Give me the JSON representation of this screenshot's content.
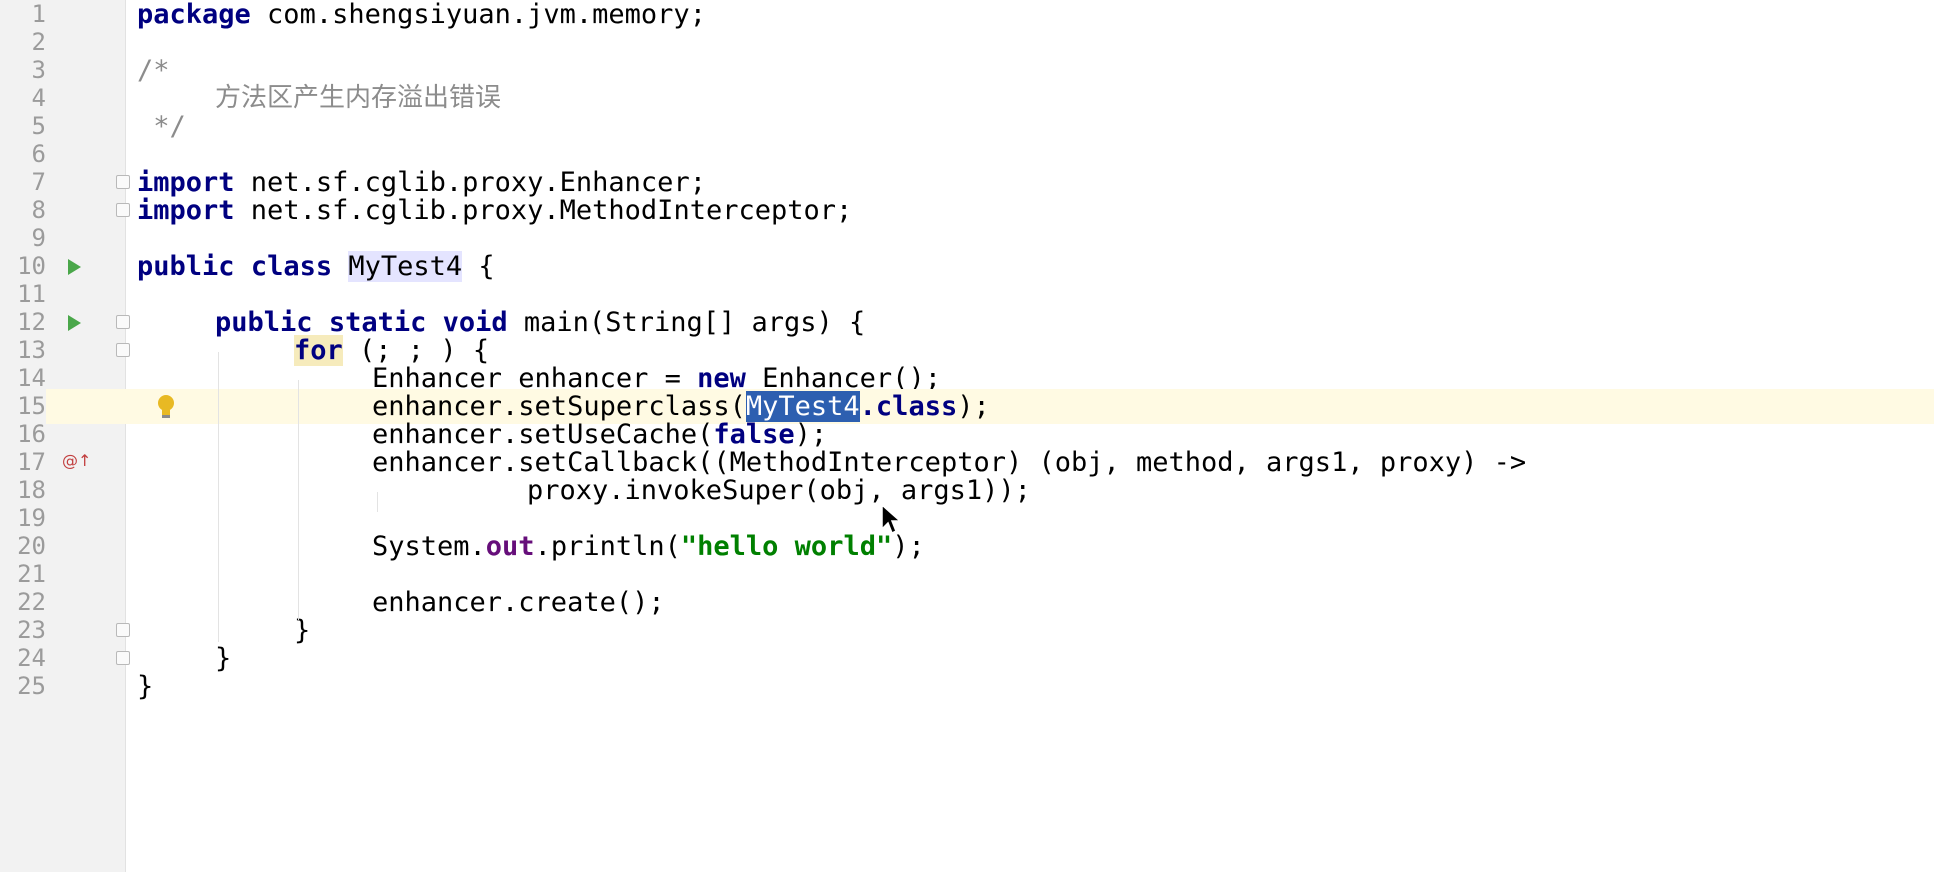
{
  "editor": {
    "current_line": 15,
    "lines": [
      {
        "n": "1",
        "text": "package com.shengsiyuan.jvm.memory;"
      },
      {
        "n": "2",
        "text": ""
      },
      {
        "n": "3",
        "text": "/*"
      },
      {
        "n": "4",
        "text": "方法区产生内存溢出错误"
      },
      {
        "n": "5",
        "text": " */"
      },
      {
        "n": "6",
        "text": ""
      },
      {
        "n": "7",
        "text": "import net.sf.cglib.proxy.Enhancer;"
      },
      {
        "n": "8",
        "text": "import net.sf.cglib.proxy.MethodInterceptor;"
      },
      {
        "n": "9",
        "text": ""
      },
      {
        "n": "10",
        "text": "public class MyTest4 {"
      },
      {
        "n": "11",
        "text": ""
      },
      {
        "n": "12",
        "text": "public static void main(String[] args) {"
      },
      {
        "n": "13",
        "text": "for (; ; ) {"
      },
      {
        "n": "14",
        "text": "Enhancer enhancer = new Enhancer();"
      },
      {
        "n": "15",
        "text": "enhancer.setSuperclass(MyTest4.class);"
      },
      {
        "n": "16",
        "text": "enhancer.setUseCache(false);"
      },
      {
        "n": "17",
        "text": "enhancer.setCallback((MethodInterceptor) (obj, method, args1, proxy) ->"
      },
      {
        "n": "18",
        "text": "proxy.invokeSuper(obj, args1));"
      },
      {
        "n": "19",
        "text": ""
      },
      {
        "n": "20",
        "text": "System.out.println(\"hello world\");"
      },
      {
        "n": "21",
        "text": ""
      },
      {
        "n": "22",
        "text": "enhancer.create();"
      },
      {
        "n": "23",
        "text": "}"
      },
      {
        "n": "24",
        "text": "}"
      },
      {
        "n": "25",
        "text": "}"
      }
    ],
    "tokens": {
      "kw_package": "package",
      "pkg_name": " com.shengsiyuan.jvm.memory;",
      "comment_open": "/*",
      "comment_body": "方法区产生内存溢出错误",
      "comment_close": " */",
      "kw_import": "import",
      "import1": " net.sf.cglib.proxy.Enhancer;",
      "import2": " net.sf.cglib.proxy.MethodInterceptor;",
      "kw_public": "public",
      "kw_class": "class",
      "class_name": "MyTest4",
      "open_brace": " {",
      "kw_static": "static",
      "kw_void": "void",
      "main_sig": " main(String[] args) {",
      "kw_for": "for",
      "for_rest": " (; ; ) {",
      "l14_a": "Enhancer enhancer = ",
      "kw_new": "new",
      "l14_b": " Enhancer();",
      "l15_a": "enhancer.setSuperclass(",
      "l15_sel": "MyTest4",
      "l15_class": ".class",
      "l15_b": ");",
      "l16_a": "enhancer.setUseCache(",
      "kw_false": "false",
      "l16_b": ");",
      "l17": "enhancer.setCallback((MethodInterceptor) (obj, method, args1, proxy) ->",
      "l18": "proxy.invokeSuper(obj, args1));",
      "l20_a": "System.",
      "l20_out": "out",
      "l20_b": ".println(",
      "l20_str": "\"hello world\"",
      "l20_c": ");",
      "l22": "enhancer.create();",
      "close_brace": "}"
    },
    "colors": {
      "keyword": "#000080",
      "comment": "#8c8c8c",
      "string": "#008000",
      "static_field": "#660e7a",
      "selection": "#2d5fb0",
      "current_line": "#fffae3",
      "gutter": "#f2f2f2"
    },
    "gutter_icons": {
      "run_line_10": "run-class-icon",
      "run_line_12": "run-main-icon",
      "override_line_17": "@↑"
    }
  }
}
